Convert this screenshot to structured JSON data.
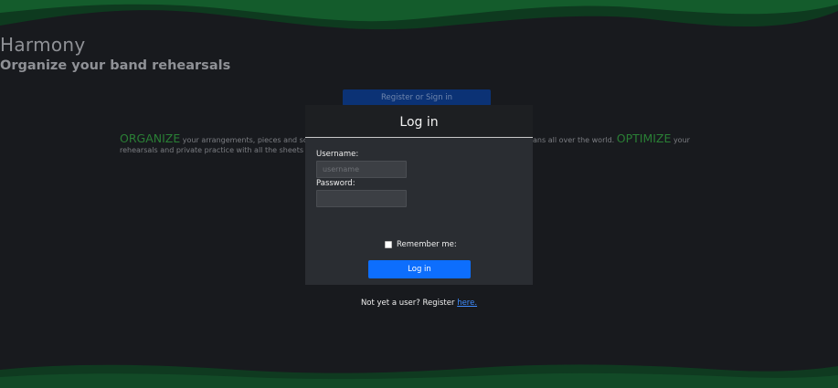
{
  "hero": {
    "title": "Harmony",
    "subtitle": "Organize your band rehearsals",
    "cta_label": "Register or Sign in"
  },
  "intro": {
    "accent_organize": "ORGANIZE",
    "text_left": " your arrangements, pieces and songs in",
    "text_right": "sicians all over the world. ",
    "accent_optimize": "OPTIMIZE",
    "text_right_end": " your",
    "line2": "rehearsals and private practice with all the sheets and tr"
  },
  "login_modal": {
    "title": "Log in",
    "username_label": "Username:",
    "username_placeholder": "username",
    "username_value": "",
    "password_label": "Password:",
    "password_value": "",
    "remember_label": "Remember me:",
    "remember_checked": false,
    "submit_label": "Log in",
    "register_prompt": "Not yet a user? Register ",
    "register_link": "here."
  },
  "colors": {
    "background": "#181a1e",
    "wave_green": "#0f4a24",
    "accent_green": "#2a7f35",
    "primary_blue": "#0d6efd"
  }
}
